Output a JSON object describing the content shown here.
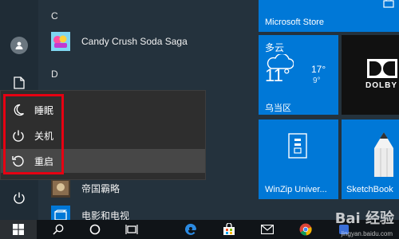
{
  "app_list": {
    "letters": [
      "C",
      "D"
    ],
    "apps": [
      {
        "label": "Candy Crush Soda Saga",
        "icon": "candy-crush-icon"
      },
      {
        "label": "帝国霸略",
        "icon": "empire-game-icon"
      },
      {
        "label": "电影和电视",
        "icon": "movies-tv-icon"
      }
    ]
  },
  "power_menu": {
    "items": [
      {
        "label": "睡眠",
        "icon": "sleep-icon"
      },
      {
        "label": "关机",
        "icon": "shutdown-icon"
      },
      {
        "label": "重启",
        "icon": "restart-icon"
      }
    ],
    "hovered": "重启",
    "highlight_color": "#e60012"
  },
  "tiles": {
    "store": {
      "label": "Microsoft Store"
    },
    "weather": {
      "condition": "多云",
      "current_temp": "11°",
      "high": "17°",
      "low": "9°",
      "location": "乌当区"
    },
    "dolby": {
      "label": "DOLBY"
    },
    "winzip": {
      "label": "WinZip Univer..."
    },
    "sketchbook": {
      "label": "SketchBook"
    }
  },
  "watermark": {
    "brand": "Bai 经验",
    "url": "jingyan.baidu.com"
  },
  "colors": {
    "accent": "#0078d7",
    "menu_bg": "#24323d",
    "taskbar_bg": "#101418"
  }
}
